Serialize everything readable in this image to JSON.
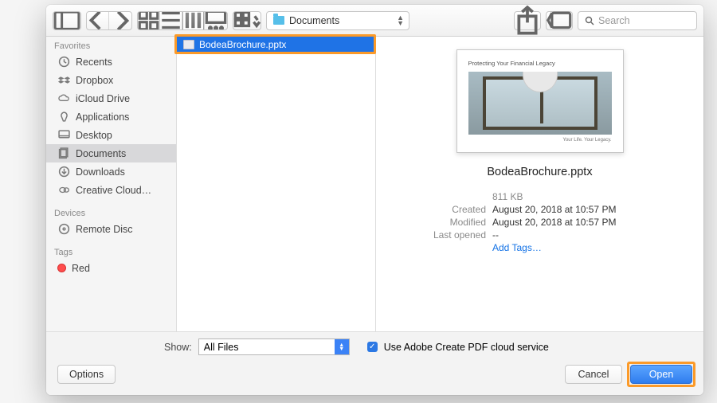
{
  "toolbar": {
    "path_label": "Documents",
    "search_placeholder": "Search"
  },
  "sidebar": {
    "sections": {
      "favorites": "Favorites",
      "devices": "Devices",
      "tags": "Tags"
    },
    "items": {
      "recents": "Recents",
      "dropbox": "Dropbox",
      "icloud": "iCloud Drive",
      "applications": "Applications",
      "desktop": "Desktop",
      "documents": "Documents",
      "downloads": "Downloads",
      "creative_cloud": "Creative Cloud…",
      "remote_disc": "Remote Disc",
      "red": "Red"
    }
  },
  "file_list": {
    "selected": "BodeaBrochure.pptx"
  },
  "preview": {
    "thumb_heading": "Protecting Your Financial Legacy",
    "thumb_footer": "Your Life. Your Legacy.",
    "filename": "BodeaBrochure.pptx",
    "size": "811 KB",
    "created_label": "Created",
    "created_value": "August 20, 2018 at 10:57 PM",
    "modified_label": "Modified",
    "modified_value": "August 20, 2018 at 10:57 PM",
    "last_opened_label": "Last opened",
    "last_opened_value": "--",
    "add_tags": "Add Tags…"
  },
  "controls": {
    "show_label": "Show:",
    "filter_value": "All Files",
    "cloud_checkbox": "Use Adobe Create PDF cloud service"
  },
  "footer": {
    "options": "Options",
    "cancel": "Cancel",
    "open": "Open"
  }
}
